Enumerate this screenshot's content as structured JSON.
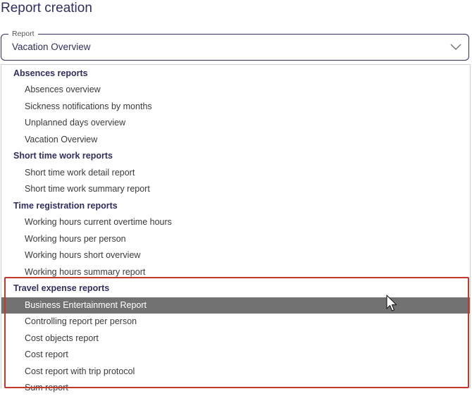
{
  "page": {
    "title": "Report creation"
  },
  "report_select": {
    "legend": "Report",
    "value": "Vacation Overview"
  },
  "dropdown": {
    "groups": [
      {
        "label": "Absences reports",
        "options": [
          "Absences overview",
          "Sickness notifications by months",
          "Unplanned days overview",
          "Vacation Overview"
        ]
      },
      {
        "label": "Short time work reports",
        "options": [
          "Short time work detail report",
          "Short time work summary report"
        ]
      },
      {
        "label": "Time registration reports",
        "options": [
          "Working hours current overtime hours",
          "Working hours per person",
          "Working hours short overview",
          "Working hours summary report"
        ]
      },
      {
        "label": "Travel expense reports",
        "options": [
          "Business Entertainment Report",
          "Controlling report per person",
          "Cost objects report",
          "Cost report",
          "Cost report with trip protocol",
          "Sum report"
        ]
      }
    ],
    "selected_option": "Business Entertainment Report"
  },
  "colors": {
    "title": "#2f2e5e",
    "selected_bg": "#727272",
    "highlight_border": "#c0392b"
  },
  "icons": {
    "select_arrow": "chevron-down-icon",
    "pointer": "mouse-cursor-icon"
  }
}
